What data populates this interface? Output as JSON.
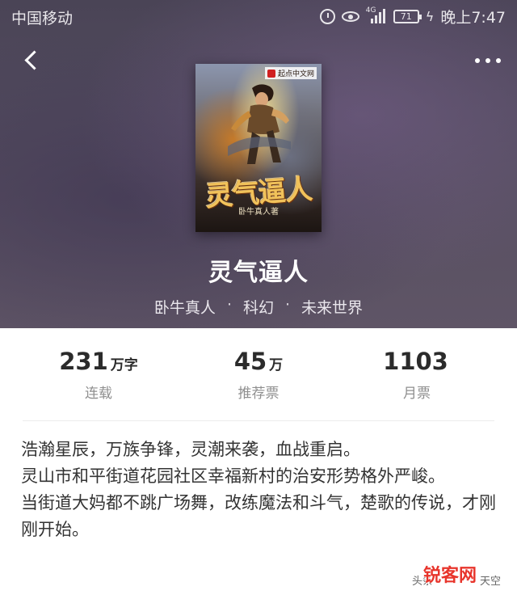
{
  "status_bar": {
    "carrier": "中国移动",
    "network_tag": "4G",
    "battery": "71",
    "time": "晚上7:47"
  },
  "nav": {
    "back_icon": "back-arrow-icon",
    "more_icon": "more-dots-icon"
  },
  "book": {
    "cover": {
      "title_art": "灵气逼人",
      "author_art": "卧牛真人著",
      "publisher": "起点中文网"
    },
    "title": "灵气逼人",
    "author": "卧牛真人",
    "category": "科幻",
    "subcategory": "未来世界",
    "separator": "·"
  },
  "stats": [
    {
      "value": "231",
      "unit": "万字",
      "label": "连载"
    },
    {
      "value": "45",
      "unit": "万",
      "label": "推荐票"
    },
    {
      "value": "1103",
      "unit": "",
      "label": "月票"
    }
  ],
  "description": {
    "lines": [
      "浩瀚星辰，万族争锋，灵潮来袭，血战重启。",
      "灵山市和平街道花园社区幸福新村的治安形势格外严峻。",
      "当街道大妈都不跳广场舞，改练魔法和斗气，楚歌的传说，才刚刚开始。"
    ]
  },
  "watermark": {
    "left": "头条",
    "brand": "锐客网",
    "right": "天空"
  },
  "colors": {
    "header_bg": "#524b5e",
    "text_dark": "#2b2b2b",
    "text_muted": "#8f8f8f",
    "watermark_red": "#e8352c"
  }
}
